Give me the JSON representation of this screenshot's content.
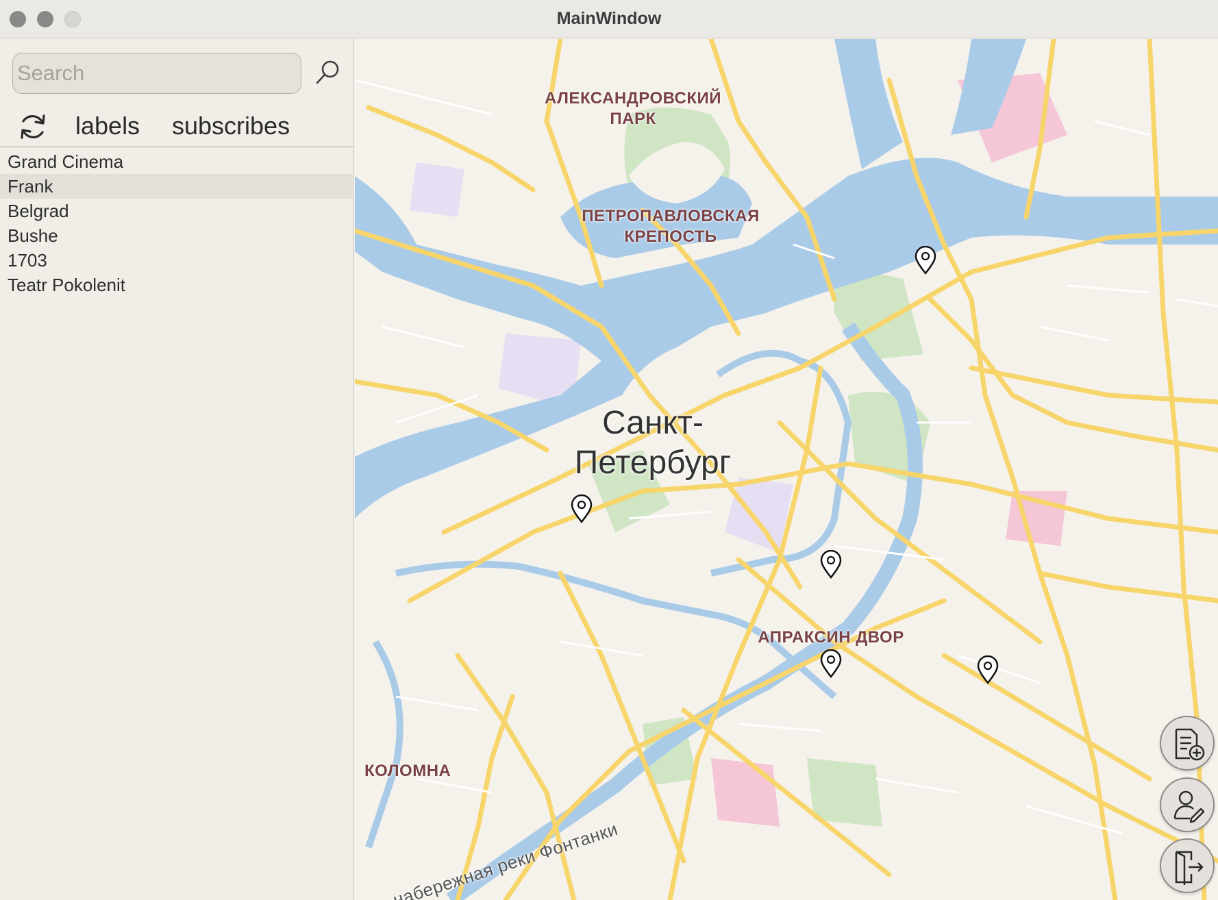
{
  "window": {
    "title": "MainWindow"
  },
  "search": {
    "placeholder": "Search",
    "value": ""
  },
  "toolbar": {
    "labels_label": "labels",
    "subscribes_label": "subscribes"
  },
  "list": {
    "items": [
      {
        "label": "Grand Cinema",
        "selected": false
      },
      {
        "label": "Frank",
        "selected": true
      },
      {
        "label": "Belgrad",
        "selected": false
      },
      {
        "label": "Bushe",
        "selected": false
      },
      {
        "label": "1703",
        "selected": false
      },
      {
        "label": "Teatr Pokolenit",
        "selected": false
      }
    ]
  },
  "map": {
    "labels": {
      "aleksandrovsky_1": "АЛЕКСАНДРОВСКИЙ",
      "aleksandrovsky_2": "ПАРК",
      "petropavlovskaya_1": "ПЕТРОПАВЛОВСКАЯ",
      "petropavlovskaya_2": "КРЕПОСТЬ",
      "city_1": "Санкт-",
      "city_2": "Петербург",
      "apraksin": "АПРАКСИН ДВОР",
      "kolomna": "КОЛОМНА",
      "fontanka": "набережная реки Фонтанки"
    },
    "markers": [
      "map-pin",
      "map-pin",
      "map-pin",
      "map-pin",
      "map-pin"
    ]
  },
  "actions": [
    "add-note-icon",
    "edit-profile-icon",
    "logout-icon"
  ],
  "colors": {
    "water": "#aacbe8",
    "road": "#f7d56a",
    "park": "#cfe5c4",
    "land": "#f5f2ec"
  }
}
